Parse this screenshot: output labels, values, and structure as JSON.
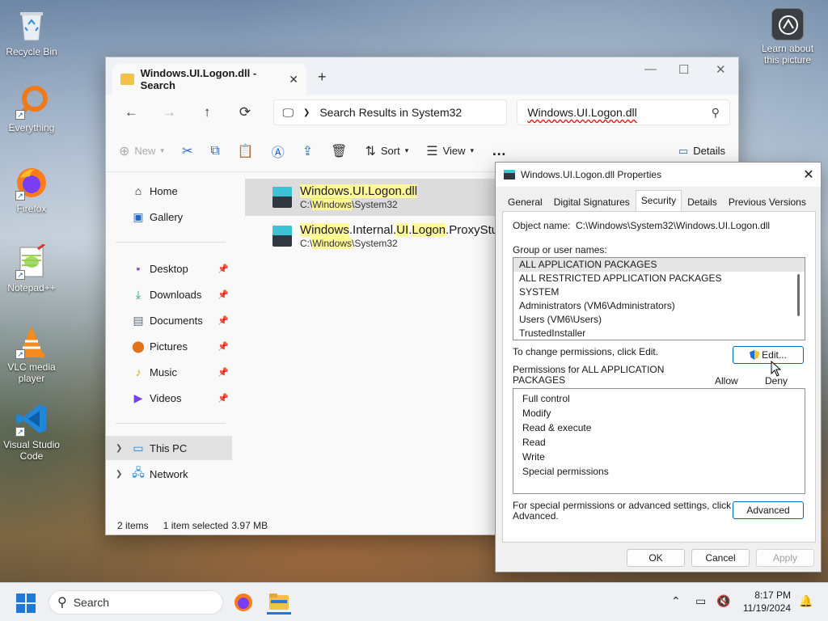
{
  "desktop": {
    "icons": [
      {
        "label": "Recycle Bin"
      },
      {
        "label": "Everything"
      },
      {
        "label": "Firefox"
      },
      {
        "label": "Notepad++"
      },
      {
        "label": "VLC media player"
      },
      {
        "label": "Visual Studio Code"
      }
    ],
    "learn_label": "Learn about this picture"
  },
  "explorer": {
    "tab_title": "Windows.UI.Logon.dll - Search",
    "address": "Search Results in System32",
    "search_query": "Windows.UI.Logon.dll",
    "commands": {
      "new": "New",
      "sort": "Sort",
      "view": "View",
      "more": "…",
      "details": "Details"
    },
    "sidebar": {
      "home": "Home",
      "gallery": "Gallery",
      "desktop": "Desktop",
      "downloads": "Downloads",
      "documents": "Documents",
      "pictures": "Pictures",
      "music": "Music",
      "videos": "Videos",
      "this_pc": "This PC",
      "network": "Network"
    },
    "results": [
      {
        "name_parts": [
          "Windows.UI.Logon.dll",
          "",
          "",
          "",
          ""
        ],
        "path_parts": [
          "C:\\",
          "Windows",
          "\\System32"
        ]
      },
      {
        "name_parts": [
          "Windows",
          ".Internal.",
          "UI",
          ".",
          "Logon",
          ".ProxyStu"
        ],
        "path_parts": [
          "C:\\",
          "Windows",
          "\\System32"
        ]
      }
    ],
    "status": {
      "items": "2 items",
      "selected": "1 item selected",
      "size": "3.97 MB"
    }
  },
  "properties": {
    "title": "Windows.UI.Logon.dll Properties",
    "tabs": [
      "General",
      "Digital Signatures",
      "Security",
      "Details",
      "Previous Versions"
    ],
    "object_label": "Object name:",
    "object_value": "C:\\Windows\\System32\\Windows.UI.Logon.dll",
    "group_label": "Group or user names:",
    "groups": [
      "ALL APPLICATION PACKAGES",
      "ALL RESTRICTED APPLICATION PACKAGES",
      "SYSTEM",
      "Administrators (VM6\\Administrators)",
      "Users (VM6\\Users)",
      "TrustedInstaller"
    ],
    "change_hint": "To change permissions, click Edit.",
    "edit_label": "Edit...",
    "perm_label_line1": "Permissions for ALL APPLICATION",
    "perm_label_line2": "PACKAGES",
    "allow": "Allow",
    "deny": "Deny",
    "permissions": [
      "Full control",
      "Modify",
      "Read & execute",
      "Read",
      "Write",
      "Special permissions"
    ],
    "advanced_hint_line1": "For special permissions or advanced settings, click",
    "advanced_hint_line2": "Advanced.",
    "advanced_label": "Advanced",
    "ok": "OK",
    "cancel": "Cancel",
    "apply": "Apply"
  },
  "taskbar": {
    "search_placeholder": "Search",
    "time": "8:17 PM",
    "date": "11/19/2024"
  }
}
